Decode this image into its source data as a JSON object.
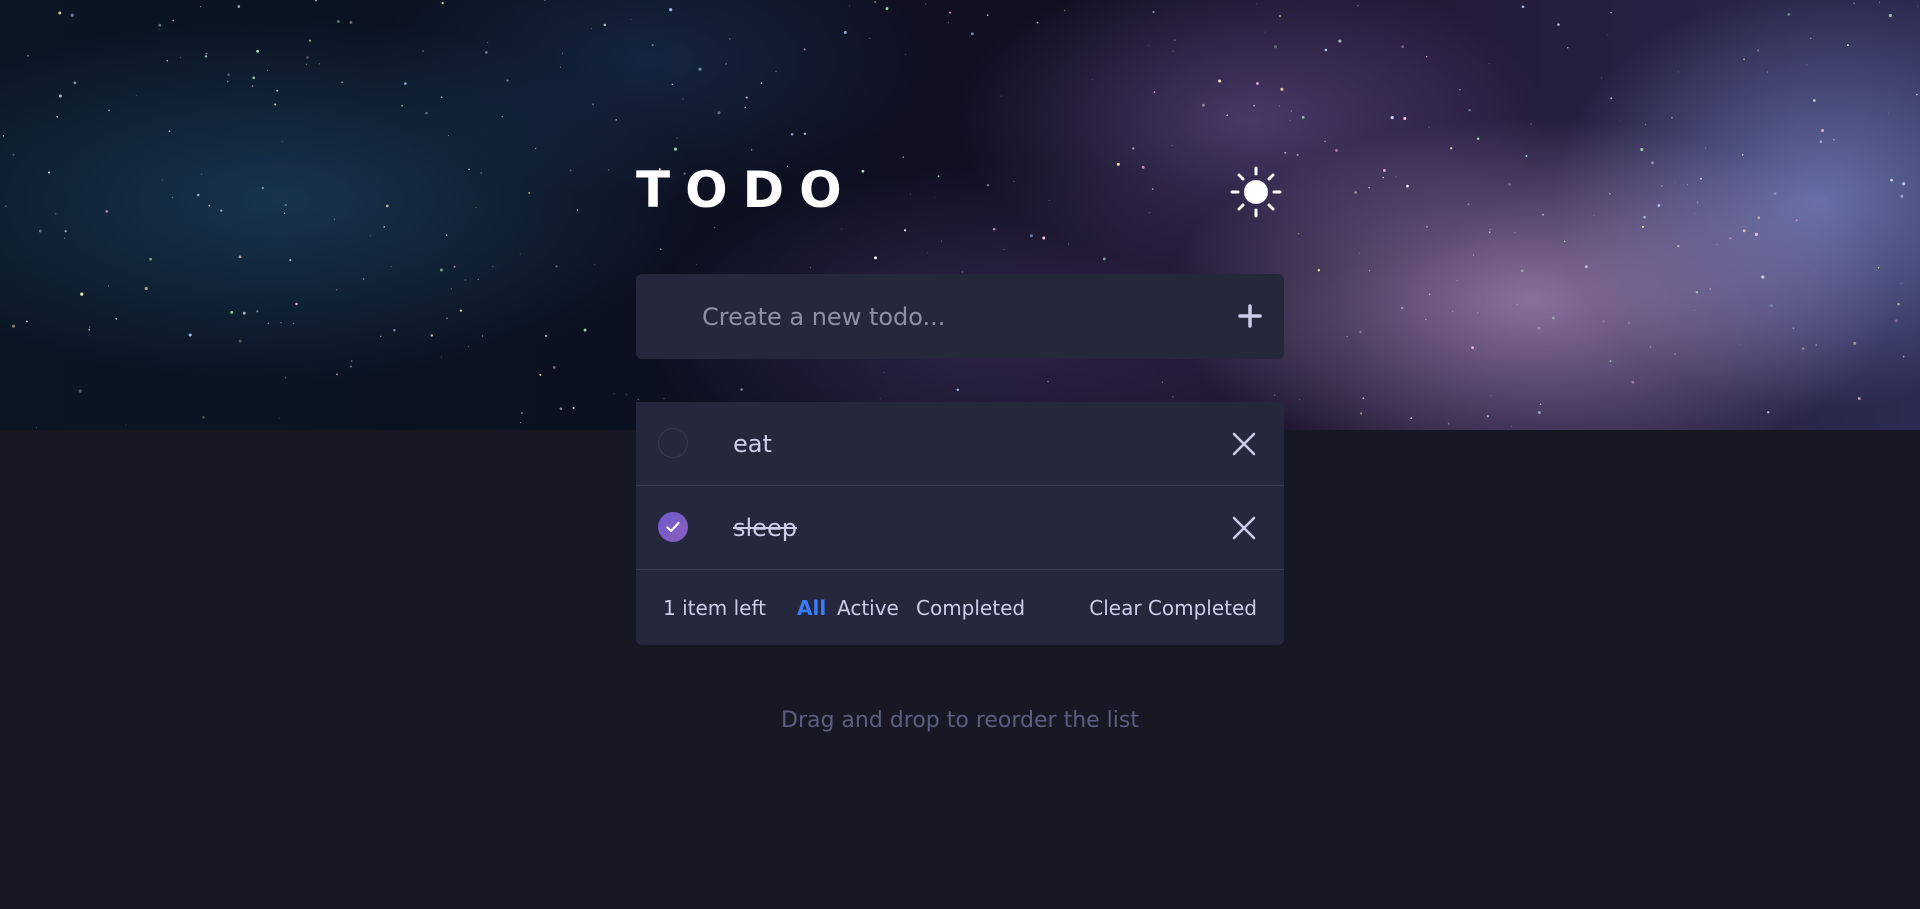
{
  "app": {
    "title": "TODO",
    "theme_toggle_icon": "sun-icon"
  },
  "new_todo": {
    "placeholder": "Create a new todo...",
    "value": "",
    "add_icon": "plus-icon"
  },
  "todos": [
    {
      "text": "eat",
      "completed": false,
      "delete_icon": "close-icon"
    },
    {
      "text": "sleep",
      "completed": true,
      "delete_icon": "close-icon"
    }
  ],
  "footer": {
    "items_left": "1 item left",
    "filters": {
      "all": "All",
      "active": "Active",
      "completed": "Completed"
    },
    "active_filter": "All",
    "clear_completed": "Clear Completed"
  },
  "hint": "Drag and drop to reorder the list",
  "colors": {
    "background": "#181824",
    "card": "#25273d",
    "text": "#cacde8",
    "accent": "#3a7bfd",
    "check_gradient_start": "#6e5ad0",
    "check_gradient_end": "#8a5fb8",
    "hint": "#5b5e7e"
  }
}
